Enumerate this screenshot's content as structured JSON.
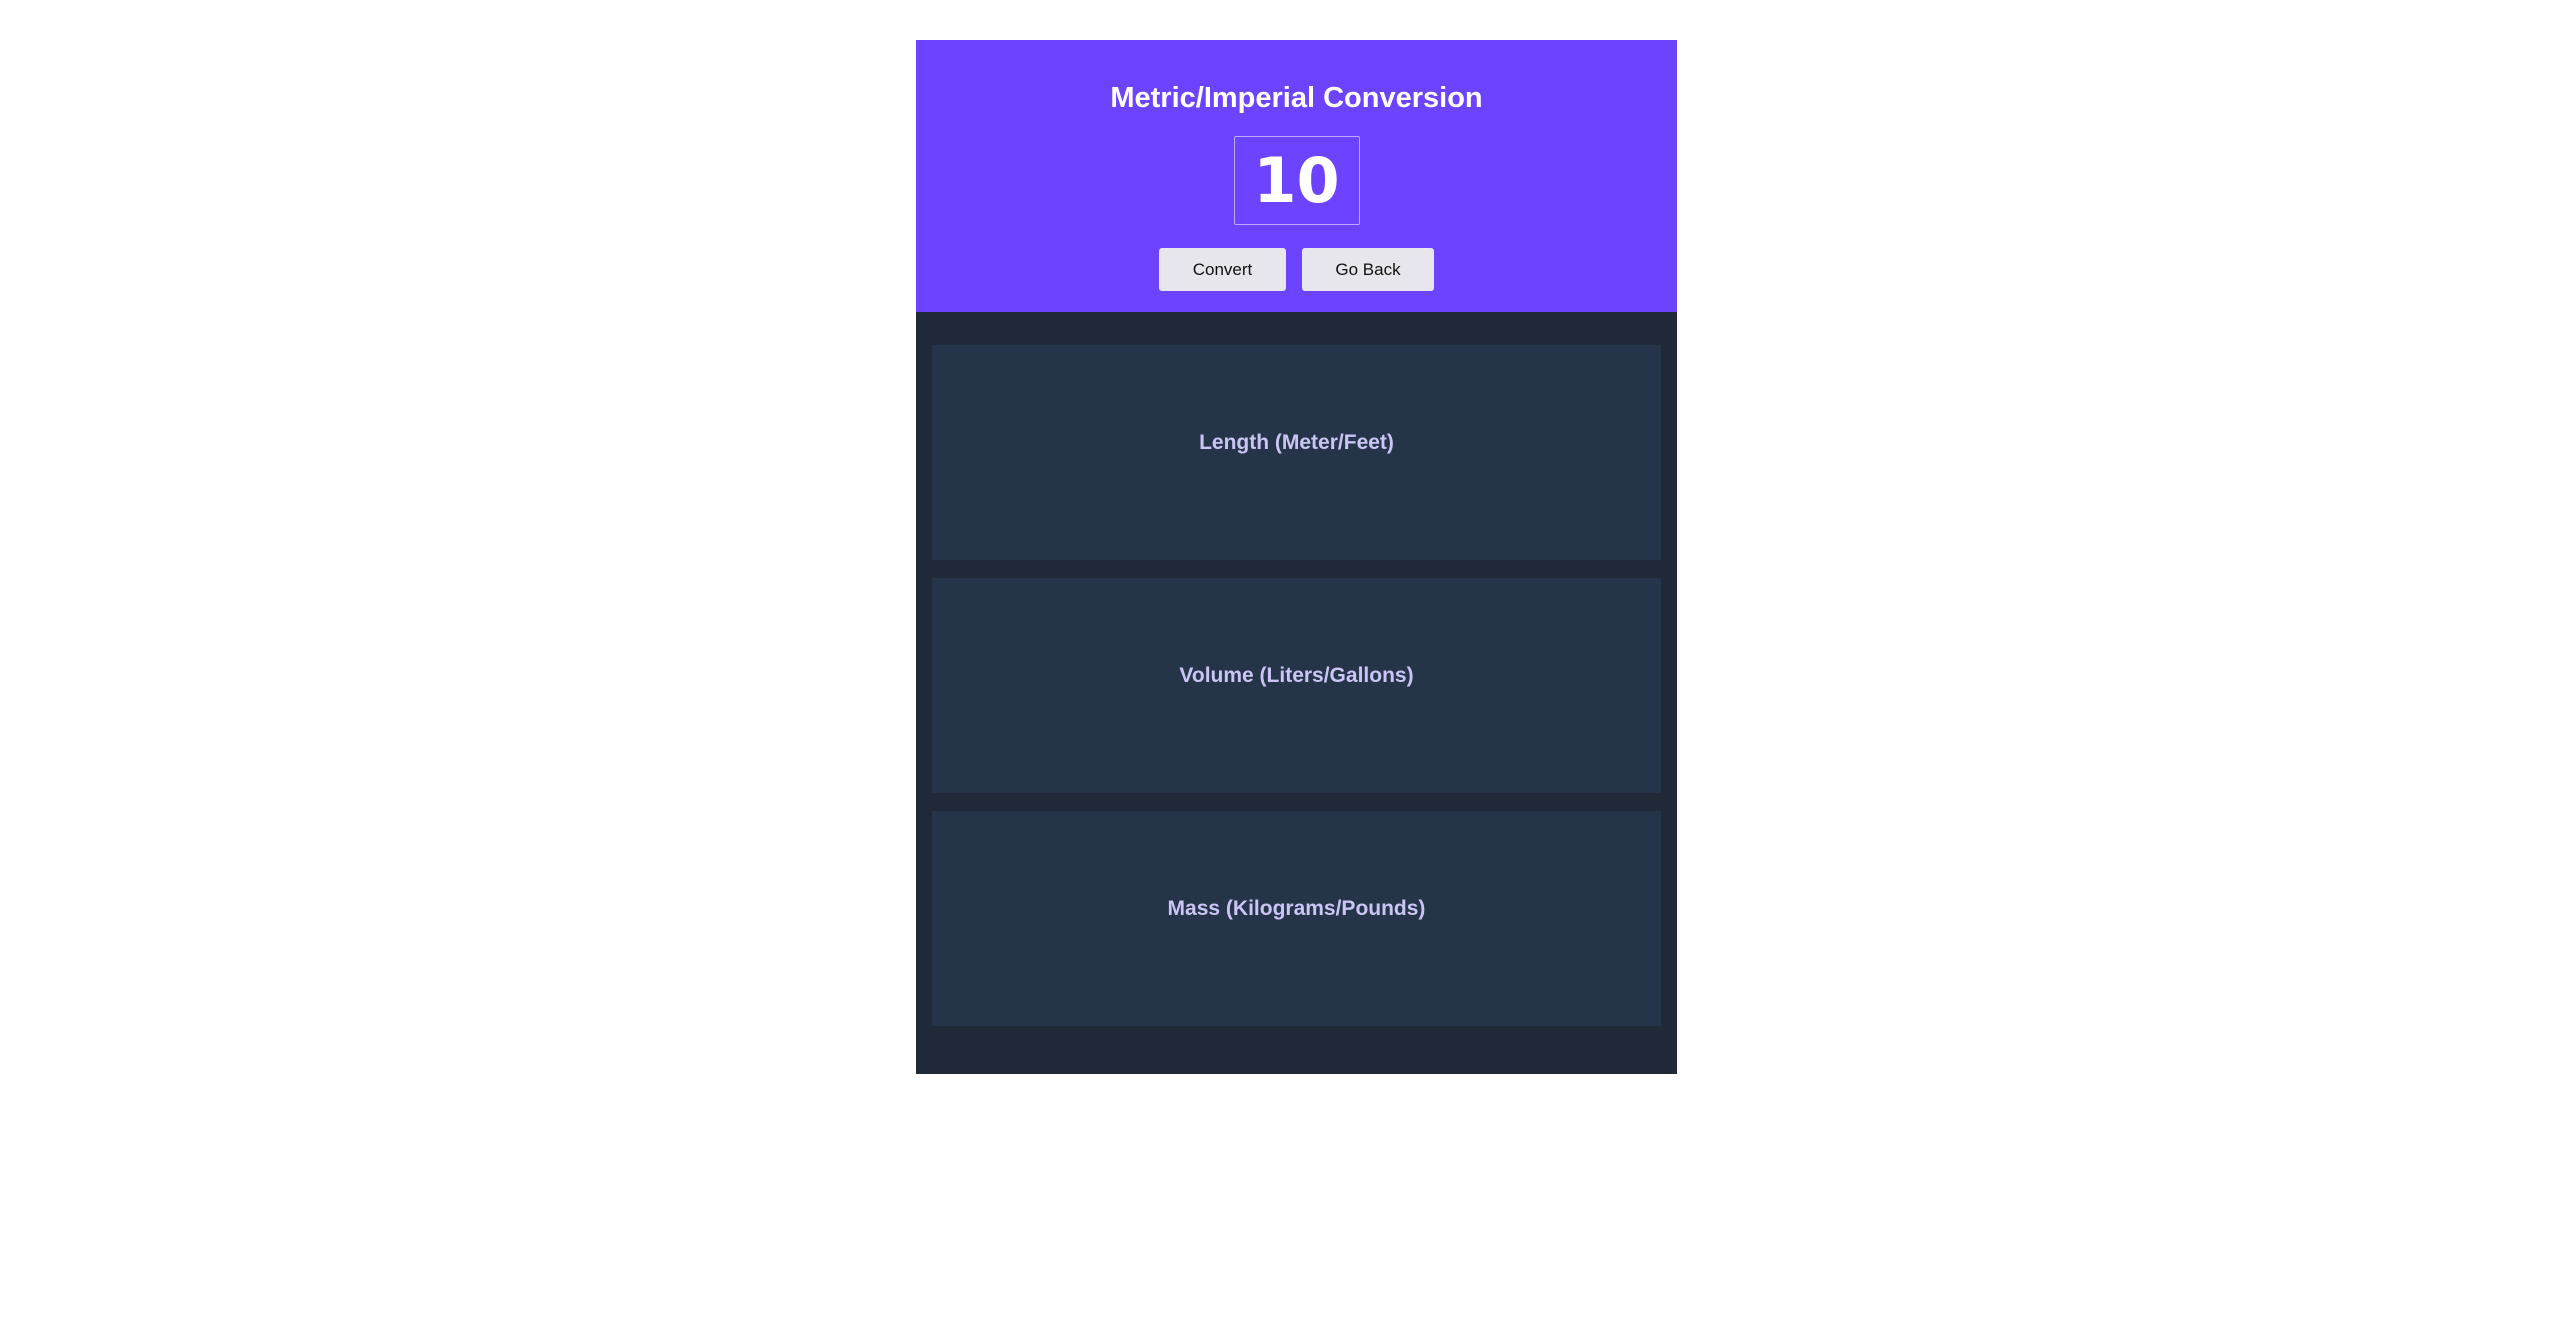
{
  "header": {
    "title": "Metric/Imperial Conversion",
    "input_value": "10",
    "convert_label": "Convert",
    "go_back_label": "Go Back"
  },
  "cards": [
    {
      "label": "Length (Meter/Feet)"
    },
    {
      "label": "Volume (Liters/Gallons)"
    },
    {
      "label": "Mass (Kilograms/Pounds)"
    }
  ],
  "colors": {
    "header_bg": "#6c43ff",
    "app_bg": "#1f2937",
    "card_bg": "#263449",
    "card_text": "#cbc5f5",
    "button_bg": "#e7e6ec"
  }
}
